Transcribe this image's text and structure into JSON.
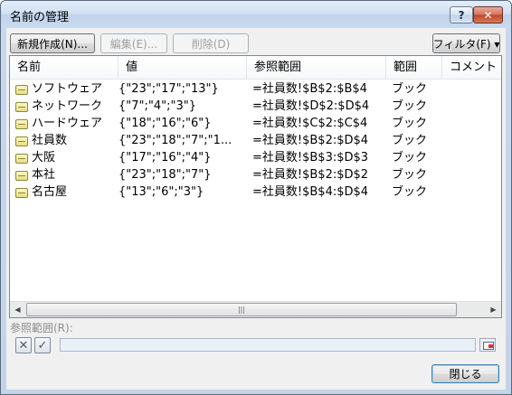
{
  "window": {
    "title": "名前の管理",
    "help_label": "?",
    "close_label": "✕"
  },
  "toolbar": {
    "new_label": "新規作成(N)...",
    "edit_label": "編集(E)...",
    "delete_label": "削除(D)",
    "filter_label": "フィルタ(F) ▾"
  },
  "table": {
    "columns": [
      "名前",
      "値",
      "参照範囲",
      "範囲",
      "コメント"
    ],
    "rows": [
      {
        "name": "ソフトウェア",
        "value": "{\"23\";\"17\";\"13\"}",
        "ref": "=社員数!$B$2:$B$4",
        "scope": "ブック",
        "comment": ""
      },
      {
        "name": "ネットワーク",
        "value": "{\"7\";\"4\";\"3\"}",
        "ref": "=社員数!$D$2:$D$4",
        "scope": "ブック",
        "comment": ""
      },
      {
        "name": "ハードウェア",
        "value": "{\"18\";\"16\";\"6\"}",
        "ref": "=社員数!$C$2:$C$4",
        "scope": "ブック",
        "comment": ""
      },
      {
        "name": "社員数",
        "value": "{\"23\";\"18\";\"7\";\"1...",
        "ref": "=社員数!$B$2:$D$4",
        "scope": "ブック",
        "comment": ""
      },
      {
        "name": "大阪",
        "value": "{\"17\";\"16\";\"4\"}",
        "ref": "=社員数!$B$3:$D$3",
        "scope": "ブック",
        "comment": ""
      },
      {
        "name": "本社",
        "value": "{\"23\";\"18\";\"7\"}",
        "ref": "=社員数!$B$2:$D$2",
        "scope": "ブック",
        "comment": ""
      },
      {
        "name": "名古屋",
        "value": "{\"13\";\"6\";\"3\"}",
        "ref": "=社員数!$B$4:$D$4",
        "scope": "ブック",
        "comment": ""
      }
    ]
  },
  "reference": {
    "label": "参照範囲(R):",
    "value": ""
  },
  "footer": {
    "close_label": "閉じる"
  },
  "colors": {
    "titlebar": "#cfdff2",
    "close_button": "#c2452b",
    "name_icon": "#e8dc86"
  }
}
